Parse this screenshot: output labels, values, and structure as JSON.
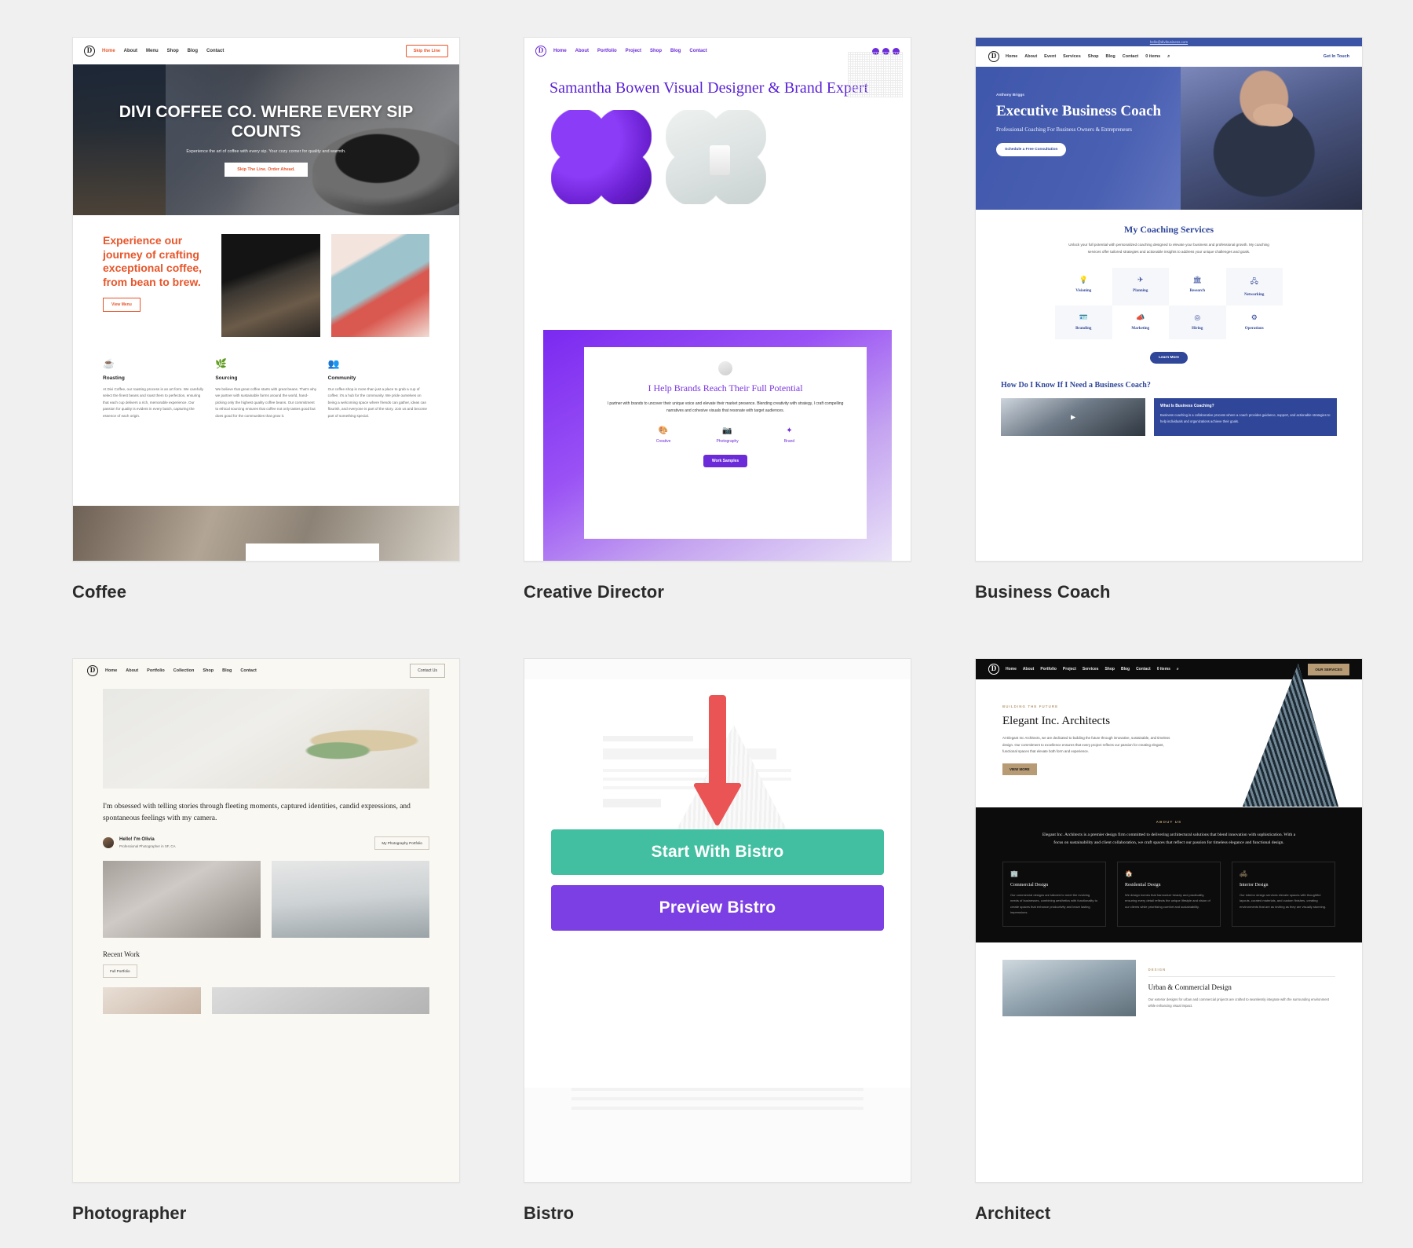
{
  "page": {
    "background": "#f0f0f0"
  },
  "cards": [
    {
      "title": "Coffee",
      "site": {
        "nav": {
          "links": [
            "Home",
            "About",
            "Menu",
            "Shop",
            "Blog",
            "Contact"
          ],
          "shop_caret": "▾",
          "cta": "Skip the Line"
        },
        "hero": {
          "heading": "DIVI COFFEE CO. WHERE EVERY SIP COUNTS",
          "sub": "Experience the art of coffee with every sip. Your cozy corner for quality and warmth.",
          "button": "Skip The Line. Order Ahead."
        },
        "intro": {
          "heading": "Experience our journey of crafting exceptional coffee, from bean to brew.",
          "button": "View Menu"
        },
        "features": [
          {
            "icon": "☕",
            "title": "Roasting",
            "text": "At Divi Coffee, our roasting process is an art form. We carefully select the finest beans and roast them to perfection, ensuring that each cup delivers a rich, memorable experience. Our passion for quality is evident in every batch, capturing the essence of each origin."
          },
          {
            "icon": "🌿",
            "title": "Sourcing",
            "text": "We believe that great coffee starts with great beans. That's why we partner with sustainable farms around the world, hand-picking only the highest quality coffee beans. Our commitment to ethical sourcing ensures that coffee not only tastes good but does good for the communities that grow it."
          },
          {
            "icon": "👥",
            "title": "Community",
            "text": "Our coffee shop is more than just a place to grab a cup of coffee; it's a hub for the community. We pride ourselves on being a welcoming space where friends can gather, ideas can flourish, and everyone is part of the story. Join us and become part of something special."
          }
        ]
      }
    },
    {
      "title": "Creative Director",
      "site": {
        "nav": {
          "links": [
            "Home",
            "About",
            "Portfolio",
            "Project",
            "Shop",
            "Blog",
            "Contact"
          ],
          "shop_caret": "▾"
        },
        "hero": {
          "heading": "Samantha Bowen Visual Designer & Brand Expert"
        },
        "panel": {
          "heading": "I Help Brands Reach Their Full Potential",
          "text": "I partner with brands to uncover their unique voice and elevate their market presence. Blending creativity with strategy, I craft compelling narratives and cohesive visuals that resonate with target audiences.",
          "icons": [
            {
              "glyph": "🎨",
              "label": "Creative"
            },
            {
              "glyph": "📷",
              "label": "Photography"
            },
            {
              "glyph": "✦",
              "label": "Brand"
            }
          ],
          "button": "Work Samples"
        }
      }
    },
    {
      "title": "Business Coach",
      "site": {
        "topbar": "hello@divibusiness.com",
        "nav": {
          "links": [
            "Home",
            "About",
            "Event",
            "Services",
            "Shop",
            "Blog",
            "Contact"
          ],
          "cart": "0 items",
          "search": "⌕",
          "cta": "Get In Touch"
        },
        "hero": {
          "eyebrow": "Anthony Briggs",
          "heading": "Executive Business Coach",
          "sub": "Professional Coaching For Business Owners & Entrepreneurs",
          "button": "Schedule a Free Consultation"
        },
        "services": {
          "heading": "My Coaching Services",
          "text": "Unlock your full potential with personalized coaching designed to elevate your business and professional growth. My coaching services offer tailored strategies and actionable insights to address your unique challenges and goals.",
          "tiles": [
            {
              "glyph": "💡",
              "label": "Visioning"
            },
            {
              "glyph": "✈",
              "label": "Planning"
            },
            {
              "glyph": "🏛",
              "label": "Research"
            },
            {
              "glyph": "🖧",
              "label": "Networking"
            },
            {
              "glyph": "🪪",
              "label": "Branding"
            },
            {
              "glyph": "📣",
              "label": "Marketing"
            },
            {
              "glyph": "◎",
              "label": "Hiring"
            },
            {
              "glyph": "⚙",
              "label": "Operations"
            }
          ],
          "button": "Learn More"
        },
        "faq": {
          "heading": "How Do I Know If I Need a Business Coach?",
          "card_title": "What Is Business Coaching?",
          "card_text": "Business coaching is a collaborative process where a coach provides guidance, support, and actionable strategies to help individuals and organizations achieve their goals."
        }
      }
    },
    {
      "title": "Photographer",
      "site": {
        "nav": {
          "links": [
            "Home",
            "About",
            "Portfolio",
            "Collection",
            "Shop",
            "Blog",
            "Contact"
          ],
          "cta": "Contact Us"
        },
        "lead": "I'm obsessed with telling stories through fleeting moments, captured identities, candid expressions, and spontaneous feelings with my camera.",
        "person": {
          "name": "Hello! I'm Olivia",
          "role": "Professional Photographer in SF, CA",
          "pill": "My Photography Portfolio"
        },
        "recent": {
          "heading": "Recent Work",
          "button": "Full Portfolio"
        }
      }
    },
    {
      "title": "Bistro",
      "site": {
        "start_button": "Start With Bistro",
        "preview_button": "Preview Bistro",
        "arrow_color": "#ea5455"
      }
    },
    {
      "title": "Architect",
      "site": {
        "nav": {
          "links": [
            "Home",
            "About",
            "Portfolio",
            "Project",
            "Services",
            "Shop",
            "Blog",
            "Contact"
          ],
          "cart": "0 items",
          "search": "⌕",
          "cta": "OUR SERVICES"
        },
        "hero": {
          "eyebrow": "BUILDING THE FUTURE",
          "heading": "Elegant Inc. Architects",
          "text": "At Elegant Inc Architects, we are dedicated to building the future through innovative, sustainable, and timeless design. Our commitment to excellence ensures that every project reflects our passion for creating elegant, functional spaces that elevate both form and experience.",
          "button": "VIEW MORE"
        },
        "about": {
          "eyebrow": "ABOUT US",
          "text": "Elegant Inc. Architects is a premier design firm committed to delivering architectural solutions that blend innovation with sophistication. With a focus on sustainability and client collaboration, we craft spaces that reflect our passion for timeless elegance and functional design.",
          "cards": [
            {
              "glyph": "🏢",
              "title": "Commercial Design",
              "text": "Our commercial designs are tailored to meet the evolving needs of businesses, combining aesthetics with functionality to create spaces that enhance productivity and leave lasting impressions."
            },
            {
              "glyph": "🏠",
              "title": "Residential Design",
              "text": "We design homes that harmonize beauty and practicality, ensuring every detail reflects the unique lifestyle and vision of our clients while prioritizing comfort and sustainability."
            },
            {
              "glyph": "🛋",
              "title": "Interior Design",
              "text": "Our interior design services elevate spaces with thoughtful layouts, curated materials, and custom finishes, creating environments that are as inviting as they are visually stunning."
            }
          ]
        },
        "lower": {
          "eyebrow": "DESIGN",
          "heading": "Urban & Commercial Design",
          "text": "Our exterior designs for urban and commercial projects are crafted to seamlessly integrate with the surrounding environment while enhancing visual impact."
        }
      }
    }
  ]
}
